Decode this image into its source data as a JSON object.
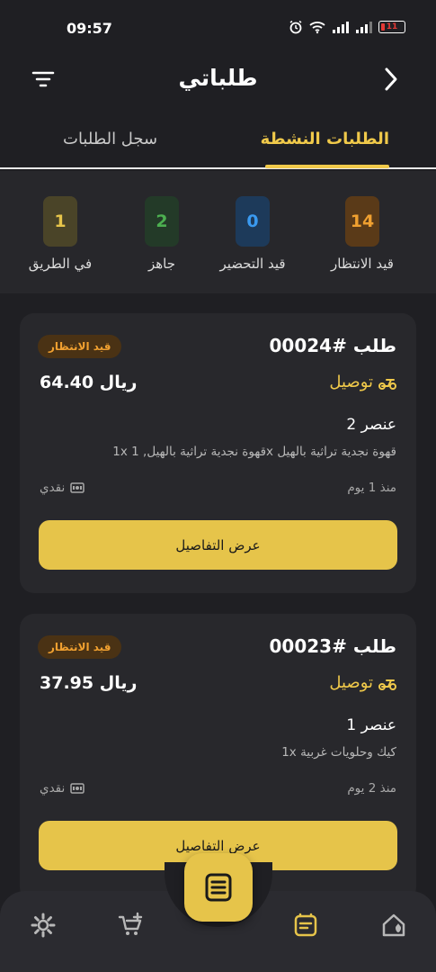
{
  "status_bar": {
    "time": "09:57",
    "battery": "11"
  },
  "header": {
    "title": "طلباتي"
  },
  "tabs": [
    {
      "label": "الطلبات النشطة",
      "active": true
    },
    {
      "label": "سجل الطلبات",
      "active": false
    }
  ],
  "summary": [
    {
      "count": "14",
      "label": "قيد الانتظار",
      "color": "#f0a030",
      "bg": "#5a3a18"
    },
    {
      "count": "0",
      "label": "قيد التحضير",
      "color": "#3a9af0",
      "bg": "#1d3a5a"
    },
    {
      "count": "2",
      "label": "جاهز",
      "color": "#4caf50",
      "bg": "#233a28"
    },
    {
      "count": "1",
      "label": "في الطريق",
      "color": "#e6c44a",
      "bg": "#4a4428"
    }
  ],
  "orders": [
    {
      "number": "طلب #00024",
      "status": "قيد الانتظار",
      "delivery": "توصيل",
      "price": "ريال 64.40",
      "item_count": "2 عنصر",
      "items": "1x قهوة نجدية تراثية بالهيل, 1x قهوة نجدية تراثية بالهيل",
      "time": "منذ 1 يوم",
      "payment": "نقدي",
      "button": "عرض التفاصيل"
    },
    {
      "number": "طلب #00023",
      "status": "قيد الانتظار",
      "delivery": "توصيل",
      "price": "ريال 37.95",
      "item_count": "1 عنصر",
      "items": "1x كيك وحلويات غربية",
      "time": "منذ 2 يوم",
      "payment": "نقدي",
      "button": "عرض التفاصيل"
    }
  ],
  "bottom_nav": {
    "items": [
      "settings-icon",
      "cart-add-icon",
      "orders-icon",
      "home-icon"
    ],
    "active": "orders-icon",
    "accent": "#e6c44a"
  }
}
